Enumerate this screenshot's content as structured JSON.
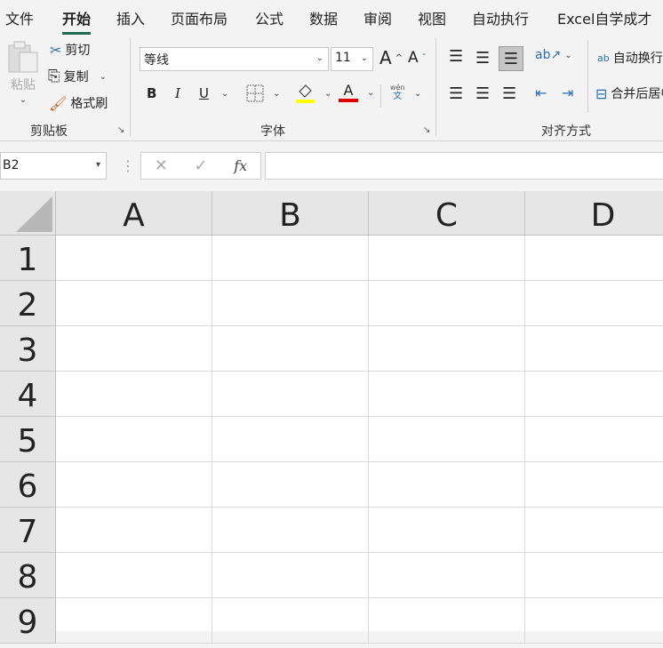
{
  "tabs": [
    "文件",
    "开始",
    "插入",
    "页面布局",
    "公式",
    "数据",
    "审阅",
    "视图",
    "自动执行",
    "Excel自学成才"
  ],
  "clipboard": {
    "paste": "粘贴",
    "cut": "剪切",
    "copy": "复制",
    "format_painter": "格式刷",
    "group": "剪贴板"
  },
  "font": {
    "name": "等线",
    "size": "11",
    "bold": "B",
    "italic": "I",
    "underline": "U",
    "phonetic_top": "wén",
    "phonetic_bottom": "文",
    "font_color_glyph": "A",
    "grow": "A",
    "shrink": "A",
    "group": "字体"
  },
  "alignment": {
    "wrap_text": "自动换行",
    "merge": "合并后居中",
    "group": "对齐方式",
    "wrap_icon": "ab"
  },
  "formula_bar": {
    "name_box": "B2",
    "fx": "fx",
    "value": ""
  },
  "columns": [
    "A",
    "B",
    "C",
    "D"
  ],
  "rows": [
    "1",
    "2",
    "3",
    "4",
    "5",
    "6",
    "7",
    "8",
    "9"
  ],
  "colors": {
    "accent": "#1e6b52",
    "fill": "#ffff00",
    "font": "#e00000"
  }
}
